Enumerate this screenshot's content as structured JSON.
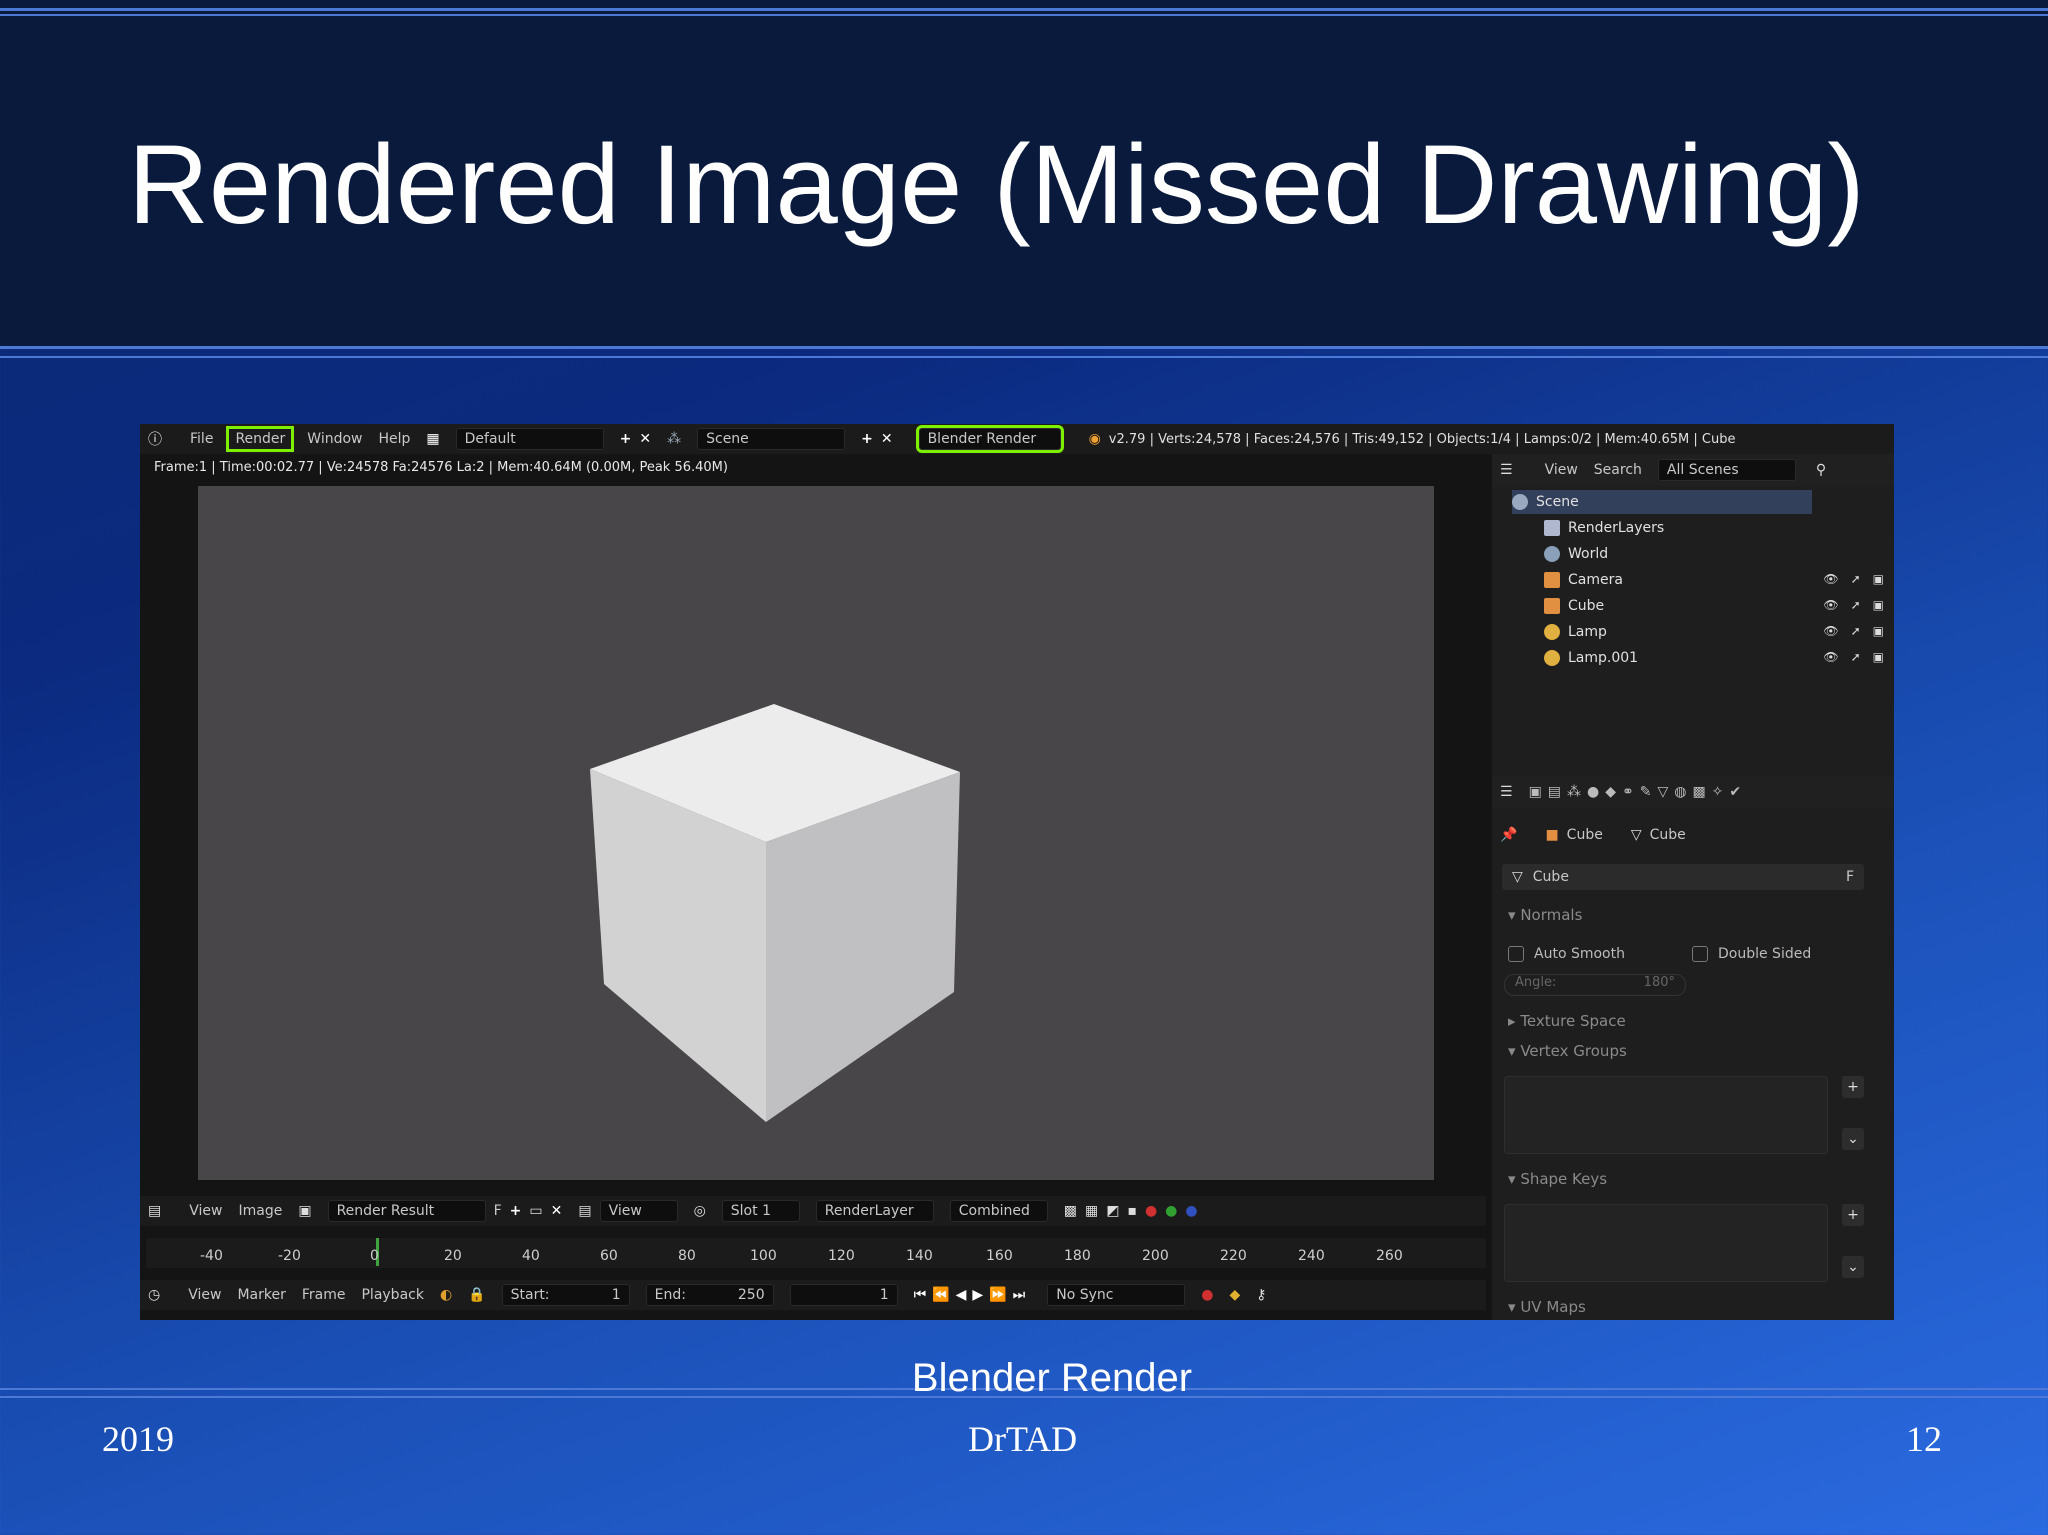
{
  "slide": {
    "title": "Rendered Image (Missed Drawing)",
    "caption": "Blender Render",
    "footer_left": "2019",
    "footer_center": "DrTAD",
    "footer_right": "12"
  },
  "blender": {
    "top_menu": {
      "items": [
        "File",
        "Render",
        "Window",
        "Help"
      ],
      "layout": "Default",
      "scene": "Scene",
      "engine": "Blender Render",
      "status": "v2.79 | Verts:24,578 | Faces:24,576 | Tris:49,152 | Objects:1/4 | Lamps:0/2 | Mem:40.65M | Cube"
    },
    "render_info": "Frame:1 | Time:00:02.77 | Ve:24578 Fa:24576 La:2 | Mem:40.64M (0.00M, Peak 56.40M)",
    "outliner": {
      "menu": [
        "View",
        "Search"
      ],
      "filter": "All Scenes",
      "items": [
        "Scene",
        "RenderLayers",
        "World",
        "Camera",
        "Cube",
        "Lamp",
        "Lamp.001"
      ]
    },
    "properties": {
      "breadcrumb": [
        "Cube",
        "Cube"
      ],
      "data_name": "Cube",
      "fake_user": "F",
      "sections": {
        "normals": "Normals",
        "auto_smooth": "Auto Smooth",
        "double_sided": "Double Sided",
        "angle_label": "Angle:",
        "angle_value": "180°",
        "texture_space": "Texture Space",
        "vertex_groups": "Vertex Groups",
        "shape_keys": "Shape Keys",
        "uv_maps": "UV Maps"
      }
    },
    "image_editor_header": {
      "menu": [
        "View",
        "Image"
      ],
      "image": "Render Result",
      "f": "F",
      "view": "View",
      "slot": "Slot 1",
      "layer": "RenderLayer",
      "pass": "Combined"
    },
    "timeline": {
      "ticks": [
        "-40",
        "-20",
        "0",
        "20",
        "40",
        "60",
        "80",
        "100",
        "120",
        "140",
        "160",
        "180",
        "200",
        "220",
        "240",
        "260"
      ],
      "menu": [
        "View",
        "Marker",
        "Frame",
        "Playback"
      ],
      "start_label": "Start:",
      "start_value": "1",
      "end_label": "End:",
      "end_value": "250",
      "current_frame": "1",
      "sync": "No Sync"
    }
  },
  "colors": {
    "highlight": "#7cf000",
    "render_bg": "#484649"
  }
}
